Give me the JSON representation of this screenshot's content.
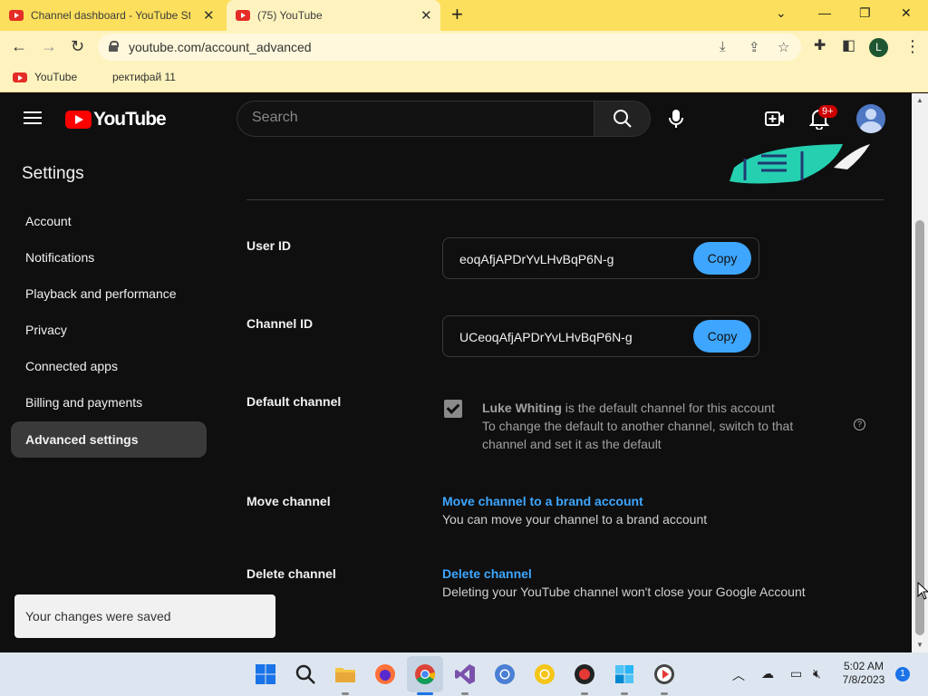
{
  "browser": {
    "tabs": [
      {
        "title": "Channel dashboard - YouTube St",
        "active": false
      },
      {
        "title": "(75) YouTube",
        "active": true
      }
    ],
    "new_tab_label": "+",
    "url": "youtube.com/account_advanced",
    "profile_initial": "L",
    "bookmarks": [
      {
        "label": "YouTube"
      },
      {
        "label": "ректифай 11"
      }
    ]
  },
  "header": {
    "logo_text": "YouTube",
    "search_placeholder": "Search",
    "notification_badge": "9+"
  },
  "sidebar": {
    "title": "Settings",
    "items": [
      {
        "label": "Account",
        "active": false
      },
      {
        "label": "Notifications",
        "active": false
      },
      {
        "label": "Playback and performance",
        "active": false
      },
      {
        "label": "Privacy",
        "active": false
      },
      {
        "label": "Connected apps",
        "active": false
      },
      {
        "label": "Billing and payments",
        "active": false
      },
      {
        "label": "Advanced settings",
        "active": true
      }
    ]
  },
  "main": {
    "user_id": {
      "label": "User ID",
      "value": "eoqAfjAPDrYvLHvBqP6N-g",
      "copy_label": "Copy"
    },
    "channel_id": {
      "label": "Channel ID",
      "value": "UCeoqAfjAPDrYvLHvBqP6N-g",
      "copy_label": "Copy"
    },
    "default_channel": {
      "label": "Default channel",
      "checked": true,
      "channel_name": "Luke Whiting",
      "line1_suffix": " is the default channel for this account",
      "line2": "To change the default to another channel, switch to that channel and set it as the default",
      "help_glyph": "?"
    },
    "move_channel": {
      "label": "Move channel",
      "link": "Move channel to a brand account",
      "description": "You can move your channel to a brand account"
    },
    "delete_channel": {
      "label": "Delete channel",
      "link": "Delete channel",
      "description": "Deleting your YouTube channel won't close your Google Account"
    }
  },
  "toast": {
    "text": "Your changes were saved"
  },
  "taskbar": {
    "time": "5:02 AM",
    "date": "7/8/2023",
    "notification_count": "1",
    "apps": [
      "start",
      "search",
      "file-explorer",
      "firefox",
      "chrome",
      "visual-studio",
      "chrome-alt",
      "app-yellow",
      "recorder",
      "app-windows",
      "media-player"
    ]
  },
  "colors": {
    "chrome_tabstrip": "#fcdf5c",
    "yt_bg": "#0f0f0f",
    "accent_blue": "#3ea6ff",
    "yt_red": "#ff0000"
  }
}
